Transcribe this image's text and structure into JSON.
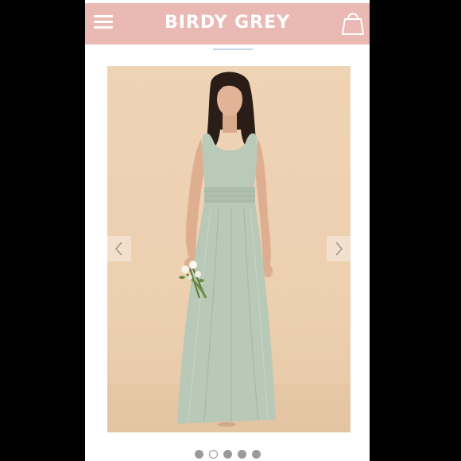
{
  "header": {
    "brand": "BIRDY GREY",
    "menu_icon": "hamburger-menu-icon",
    "bag_icon": "shopping-bag-icon",
    "background_color": "#eab9b4"
  },
  "gallery": {
    "image_subject": "model-in-sage-green-maxi-dress-holding-bouquet",
    "prev_icon": "chevron-left-icon",
    "next_icon": "chevron-right-icon",
    "slide_count": 5,
    "active_slide": 2
  },
  "colors": {
    "dress": "#b8c9b8",
    "backdrop": "#efd3b5"
  }
}
